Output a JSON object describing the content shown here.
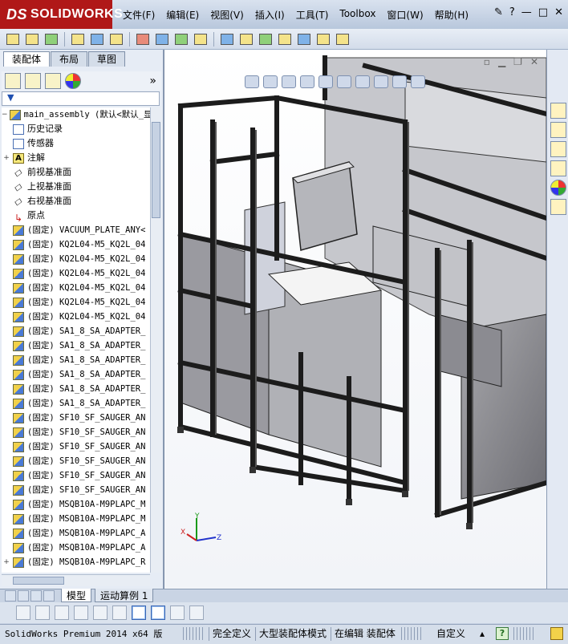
{
  "app": {
    "brand_ds": "DS",
    "brand_name": "SOLIDWORKS",
    "menu": [
      "文件(F)",
      "编辑(E)",
      "视图(V)",
      "插入(I)",
      "工具(T)",
      "Toolbox",
      "窗口(W)",
      "帮助(H)"
    ],
    "help_symbol": "?",
    "window_controls": [
      "—",
      "□",
      "✕"
    ]
  },
  "panel": {
    "tabs": [
      "装配体",
      "布局",
      "草图"
    ],
    "collapse_symbol": "»",
    "filter_symbol": "▼"
  },
  "tree": {
    "root": "main_assembly  (默认<默认_显",
    "items": [
      {
        "label": "历史记录",
        "kind": "history",
        "expand": ""
      },
      {
        "label": "传感器",
        "kind": "sensor",
        "expand": ""
      },
      {
        "label": "注解",
        "kind": "note",
        "expand": "+"
      },
      {
        "label": "前视基准面",
        "kind": "plane",
        "expand": ""
      },
      {
        "label": "上视基准面",
        "kind": "plane",
        "expand": ""
      },
      {
        "label": "右视基准面",
        "kind": "plane",
        "expand": ""
      },
      {
        "label": "原点",
        "kind": "origin",
        "expand": ""
      },
      {
        "label": "(固定) VACUUM_PLATE_ANY<",
        "kind": "part",
        "expand": ""
      },
      {
        "label": "(固定) KQ2L04-M5_KQ2L_04",
        "kind": "part",
        "expand": ""
      },
      {
        "label": "(固定) KQ2L04-M5_KQ2L_04",
        "kind": "part",
        "expand": ""
      },
      {
        "label": "(固定) KQ2L04-M5_KQ2L_04",
        "kind": "part",
        "expand": ""
      },
      {
        "label": "(固定) KQ2L04-M5_KQ2L_04",
        "kind": "part",
        "expand": ""
      },
      {
        "label": "(固定) KQ2L04-M5_KQ2L_04",
        "kind": "part",
        "expand": ""
      },
      {
        "label": "(固定) KQ2L04-M5_KQ2L_04",
        "kind": "part",
        "expand": ""
      },
      {
        "label": "(固定) SA1_8_SA_ADAPTER_",
        "kind": "part",
        "expand": ""
      },
      {
        "label": "(固定) SA1_8_SA_ADAPTER_",
        "kind": "part",
        "expand": ""
      },
      {
        "label": "(固定) SA1_8_SA_ADAPTER_",
        "kind": "part",
        "expand": ""
      },
      {
        "label": "(固定) SA1_8_SA_ADAPTER_",
        "kind": "part",
        "expand": ""
      },
      {
        "label": "(固定) SA1_8_SA_ADAPTER_",
        "kind": "part",
        "expand": ""
      },
      {
        "label": "(固定) SA1_8_SA_ADAPTER_",
        "kind": "part",
        "expand": ""
      },
      {
        "label": "(固定) SF10_SF_SAUGER_AN",
        "kind": "part",
        "expand": ""
      },
      {
        "label": "(固定) SF10_SF_SAUGER_AN",
        "kind": "part",
        "expand": ""
      },
      {
        "label": "(固定) SF10_SF_SAUGER_AN",
        "kind": "part",
        "expand": ""
      },
      {
        "label": "(固定) SF10_SF_SAUGER_AN",
        "kind": "part",
        "expand": ""
      },
      {
        "label": "(固定) SF10_SF_SAUGER_AN",
        "kind": "part",
        "expand": ""
      },
      {
        "label": "(固定) SF10_SF_SAUGER_AN",
        "kind": "part",
        "expand": ""
      },
      {
        "label": "(固定) MSQB10A-M9PLAPC_M",
        "kind": "part",
        "expand": ""
      },
      {
        "label": "(固定) MSQB10A-M9PLAPC_M",
        "kind": "part",
        "expand": ""
      },
      {
        "label": "(固定) MSQB10A-M9PLAPC_A",
        "kind": "part",
        "expand": ""
      },
      {
        "label": "(固定) MSQB10A-M9PLAPC_A",
        "kind": "part",
        "expand": ""
      },
      {
        "label": "(固定) MSQB10A-M9PLAPC_R",
        "kind": "part",
        "expand": "+"
      }
    ]
  },
  "triad": {
    "x": "Z",
    "y": "Y",
    "z": "X"
  },
  "bottom_tabs": [
    "模型",
    "运动算例 1"
  ],
  "status": {
    "app": "SolidWorks Premium 2014 x64 版",
    "definition": "完全定义",
    "mode": "大型装配体模式",
    "editing": "在编辑 装配体",
    "custom": "自定义",
    "arrow": "▴",
    "help": "?"
  }
}
